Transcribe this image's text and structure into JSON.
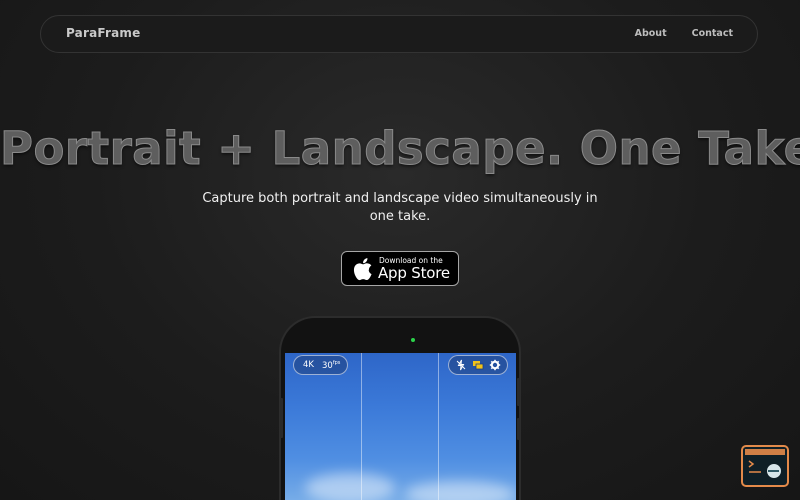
{
  "nav": {
    "brand": "ParaFrame",
    "links": [
      {
        "label": "About"
      },
      {
        "label": "Contact"
      }
    ]
  },
  "hero": {
    "title": "Portrait + Landscape. One Take",
    "subtitle": "Capture both portrait and landscape video simultaneously in one take."
  },
  "appstore": {
    "small": "Download on the",
    "big": "App Store"
  },
  "phone": {
    "resolution": "4K",
    "fps": "30",
    "fps_unit": "fps",
    "status_light": "#2bd24a",
    "icons": [
      "flash-off-icon",
      "dual-frame-icon",
      "gear-icon"
    ]
  },
  "colors": {
    "widget_border": "#e38a4a"
  }
}
